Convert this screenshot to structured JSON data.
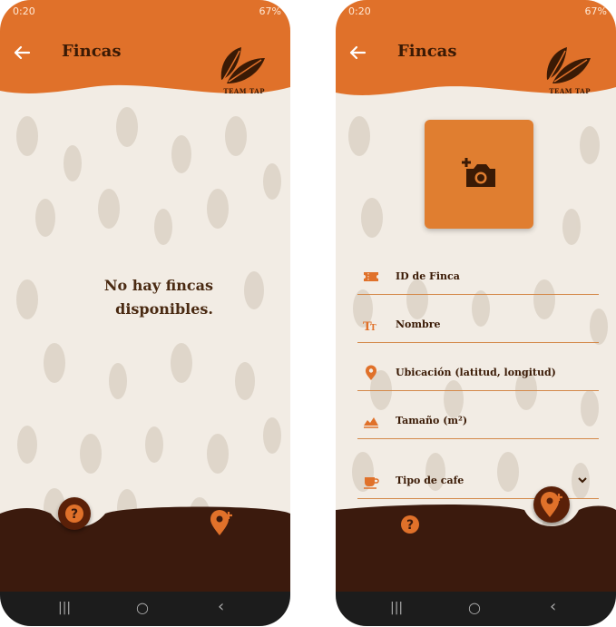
{
  "status": {
    "time": "0:20",
    "icons": "67%"
  },
  "left": {
    "title": "Fincas",
    "logo_text": "TEAM TAP",
    "empty_line1": "No hay fincas",
    "empty_line2": "disponibles."
  },
  "right": {
    "title": "Fincas",
    "logo_text": "TEAM TAP",
    "fields": {
      "id": "ID de Finca",
      "nombre": "Nombre",
      "ubicacion": "Ubicación (latitud, longitud)",
      "tamano": "Tamaño (m²)",
      "tipo": "Tipo de cafe"
    }
  },
  "colors": {
    "accent": "#e0712a",
    "dark_brown": "#3a1a05",
    "bottom": "#3b1a0d",
    "navbar": "#1c1c1c"
  }
}
